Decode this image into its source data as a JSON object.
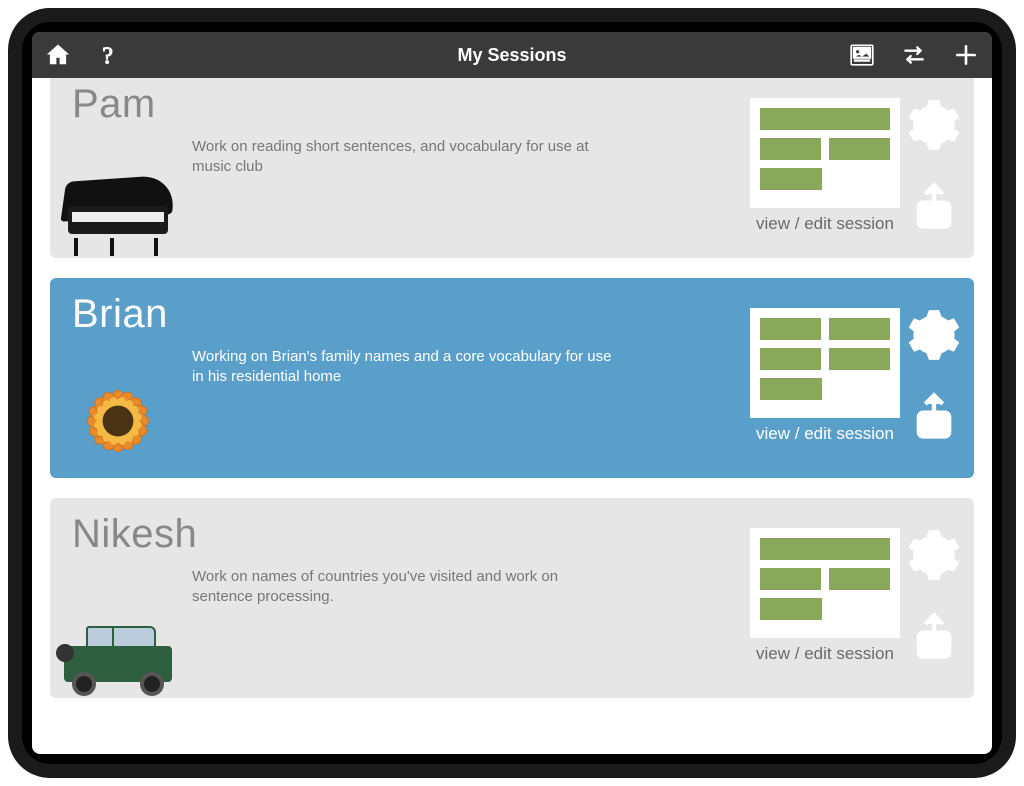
{
  "header": {
    "title": "My Sessions"
  },
  "sessions": [
    {
      "name": "Pam",
      "description": "Work on reading short sentences, and vocabulary for use at music club",
      "view_edit_label": "view / edit session",
      "thumb": "piano",
      "selected": false
    },
    {
      "name": "Brian",
      "description": "Working on Brian's family names and a core vocabulary for use in his residential home",
      "view_edit_label": "view / edit session",
      "thumb": "sunflower",
      "selected": true
    },
    {
      "name": "Nikesh",
      "description": "Work on names of countries you've visited and work on sentence processing.",
      "view_edit_label": "view / edit session",
      "thumb": "jeep",
      "selected": false
    }
  ]
}
